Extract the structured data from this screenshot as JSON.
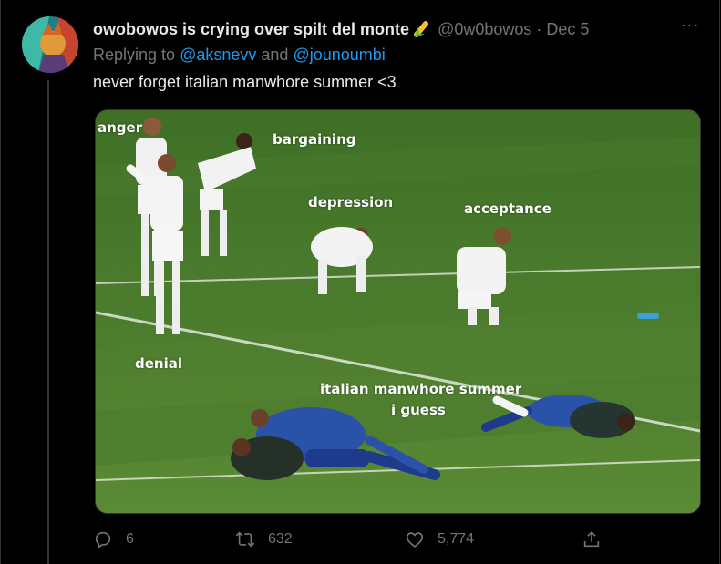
{
  "tweet": {
    "display_name": "owobowos is crying over spilt del monte",
    "name_emoji": "corn-icon",
    "handle": "@0w0bowos",
    "separator": "·",
    "date": "Dec 5",
    "replying_prefix": "Replying to",
    "reply_mention_1": "@aksnevv",
    "reply_conjunction": "and",
    "reply_mention_2": "@jounoumbi",
    "text": "never forget italian manwhore summer <3",
    "more_label": "···"
  },
  "media_labels": {
    "anger": "anger",
    "bargaining": "bargaining",
    "depression": "depression",
    "acceptance": "acceptance",
    "denial": "denial",
    "italian_line1": "italian manwhore summer",
    "italian_line2": "i guess"
  },
  "actions": {
    "replies": "6",
    "retweets": "632",
    "likes": "5,774"
  },
  "colors": {
    "background": "#000000",
    "text_primary": "#e7e9ea",
    "text_secondary": "#71767b",
    "accent": "#1d9bf0",
    "pitch_green": "#4f7f2e"
  }
}
